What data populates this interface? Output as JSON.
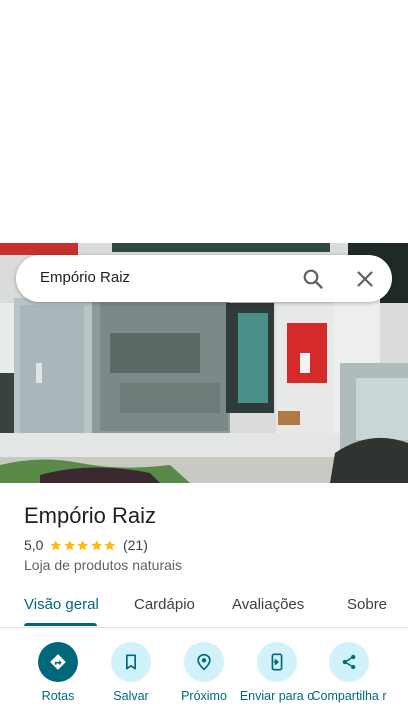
{
  "search": {
    "query": "Empório Raiz"
  },
  "place": {
    "name": "Empório Raiz",
    "rating": "5,0",
    "stars": 5,
    "review_count": "(21)",
    "category": "Loja de produtos naturais"
  },
  "tabs": [
    {
      "label": "Visão geral",
      "active": true
    },
    {
      "label": "Cardápio",
      "active": false
    },
    {
      "label": "Avaliações",
      "active": false
    },
    {
      "label": "Sobre",
      "active": false
    }
  ],
  "actions": [
    {
      "label": "Rotas",
      "icon": "directions-icon"
    },
    {
      "label": "Salvar",
      "icon": "bookmark-icon"
    },
    {
      "label": "Próximo",
      "icon": "nearby-icon"
    },
    {
      "label": "Enviar para o",
      "icon": "send-to-phone-icon"
    },
    {
      "label": "Compartilha r",
      "icon": "share-icon"
    }
  ],
  "colors": {
    "accent": "#00687a",
    "action_bg": "#d1f2fb",
    "star": "#fbbc04"
  }
}
